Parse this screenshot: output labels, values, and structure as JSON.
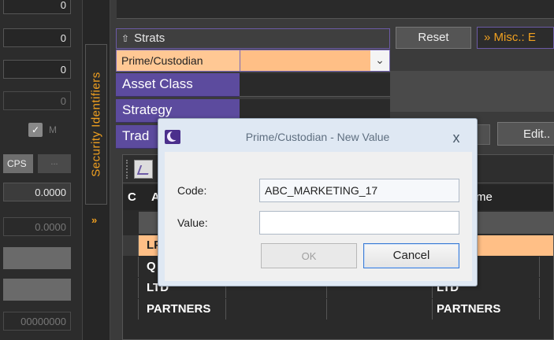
{
  "left_panel": {
    "values": [
      "0",
      "0",
      "0",
      "0",
      "0.0000",
      "0.0000",
      "00000000"
    ],
    "checkbox_mark": "✓",
    "checkbox_label": "M",
    "cps_label": "CPS",
    "dots_label": "..."
  },
  "vertical_tab": {
    "label": "Security Identifiers",
    "chevron": "»"
  },
  "strats": {
    "header": "Strats",
    "chevron": "»",
    "rows": [
      {
        "label": "Prime/Custodian"
      },
      {
        "label": "Asset Class"
      },
      {
        "label": "Strategy"
      },
      {
        "label": "Trad"
      }
    ]
  },
  "toolbar": {
    "reset_label": "Reset",
    "misc_label": "» Misc.: E",
    "edit_label": "Edit.."
  },
  "grid": {
    "headers": {
      "c": "C",
      "a": "A",
      "me": "me"
    },
    "rows": [
      {
        "a": "LP",
        "b": "",
        "selected": true
      },
      {
        "a": "Q",
        "b": "",
        "selected": false
      },
      {
        "a": "LTD",
        "b": "LTD",
        "selected": false
      },
      {
        "a": "PARTNERS",
        "b": "PARTNERS",
        "selected": false
      }
    ]
  },
  "modal": {
    "title": "Prime/Custodian - New Value",
    "close": "x",
    "code_label": "Code:",
    "code_value": "ABC_MARKETING_17",
    "value_label": "Value:",
    "value_value": "",
    "ok_label": "OK",
    "cancel_label": "Cancel"
  },
  "colors": {
    "accent_purple": "#5c4b9e",
    "accent_orange": "#f0a020",
    "selection": "#ffbf86",
    "dialog_bg": "#dfe8f3"
  }
}
